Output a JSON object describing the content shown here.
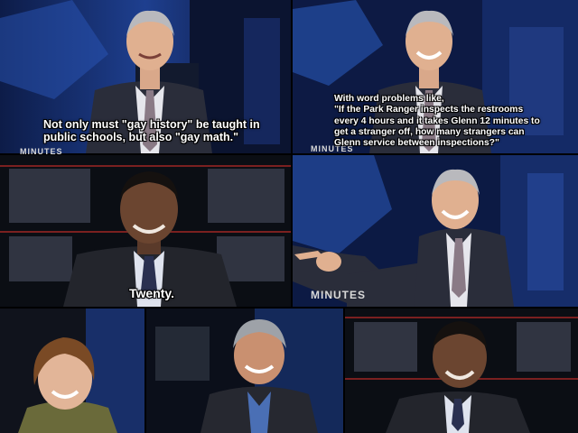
{
  "captions": {
    "joke": "Not only must \"gay history\" be taught in\npublic schools, but also \"gay math.\"",
    "word_problem": "With word problems like,\n\"If the Park Ranger inspects the restrooms\nevery 4 hours and it takes Glenn 12 minutes to\nget a stranger off, how many strangers can\nGlenn service between inspections?\"",
    "answer": "Twenty."
  },
  "show_graphics": {
    "lower_third_partial_a": "MINUTES",
    "lower_third_partial_b": "MINUTES",
    "lower_third_full": "MINUTES"
  },
  "colors": {
    "background": "#000000",
    "caption_text": "#ffffff",
    "caption_outline": "#000000",
    "studio_blue": "#1e3f8f"
  }
}
